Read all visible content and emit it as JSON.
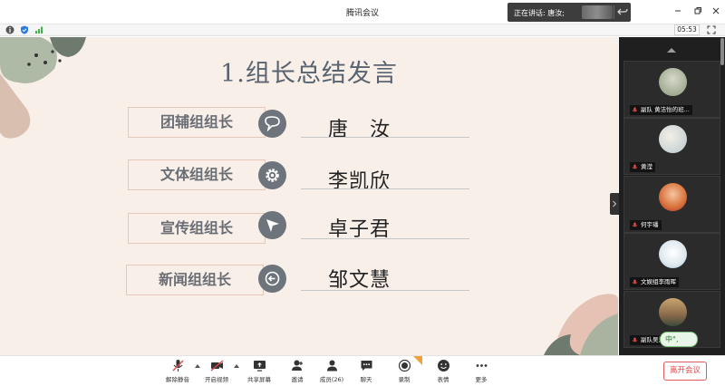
{
  "window": {
    "title": "腾讯会议",
    "speaking_label": "正在讲话: 唐汝;"
  },
  "infobar": {
    "timer": "05:53"
  },
  "slide": {
    "title": "1.组长总结发言",
    "rows": [
      {
        "role": "团辅组组长",
        "name": "唐　汝",
        "icon": "speech-bubble-icon"
      },
      {
        "role": "文体组组长",
        "name": "李凯欣",
        "icon": "gear-icon"
      },
      {
        "role": "宣传组组长",
        "name": "卓子君",
        "icon": "paper-plane-icon"
      },
      {
        "role": "新闻组组长",
        "name": "邹文慧",
        "icon": "arrow-circle-icon"
      }
    ]
  },
  "participants": [
    {
      "name": "副队 黄洁怡的班...",
      "avatar_color": "#8a9a78"
    },
    {
      "name": "黄滢",
      "avatar_color": "#b9c6cf"
    },
    {
      "name": "何宇璠",
      "avatar_color": "#d8703a"
    },
    {
      "name": "文娱组李雨晖",
      "avatar_color": "#dfe8ee"
    },
    {
      "name": "副队吴汉...",
      "avatar_color": "#8a6a4a"
    }
  ],
  "toolbar": {
    "items": [
      {
        "label": "解除静音",
        "icon": "microphone-muted-icon"
      },
      {
        "label": "开启视频",
        "icon": "camera-off-icon"
      },
      {
        "label": "共享屏幕",
        "icon": "share-screen-icon"
      },
      {
        "label": "邀请",
        "icon": "invite-icon"
      },
      {
        "label": "成员(26)",
        "icon": "members-icon"
      },
      {
        "label": "聊天",
        "icon": "chat-icon"
      },
      {
        "label": "录制",
        "icon": "record-icon"
      },
      {
        "label": "表情",
        "icon": "emoji-icon"
      },
      {
        "label": "更多",
        "icon": "more-icon"
      }
    ],
    "leave_label": "离开会议"
  },
  "ime": {
    "label": "中°,"
  },
  "colors": {
    "slide_bg": "#f8efe9",
    "role_border": "#e4c8b8",
    "icon_circle": "#6d747b",
    "leave_red": "#e04848"
  }
}
